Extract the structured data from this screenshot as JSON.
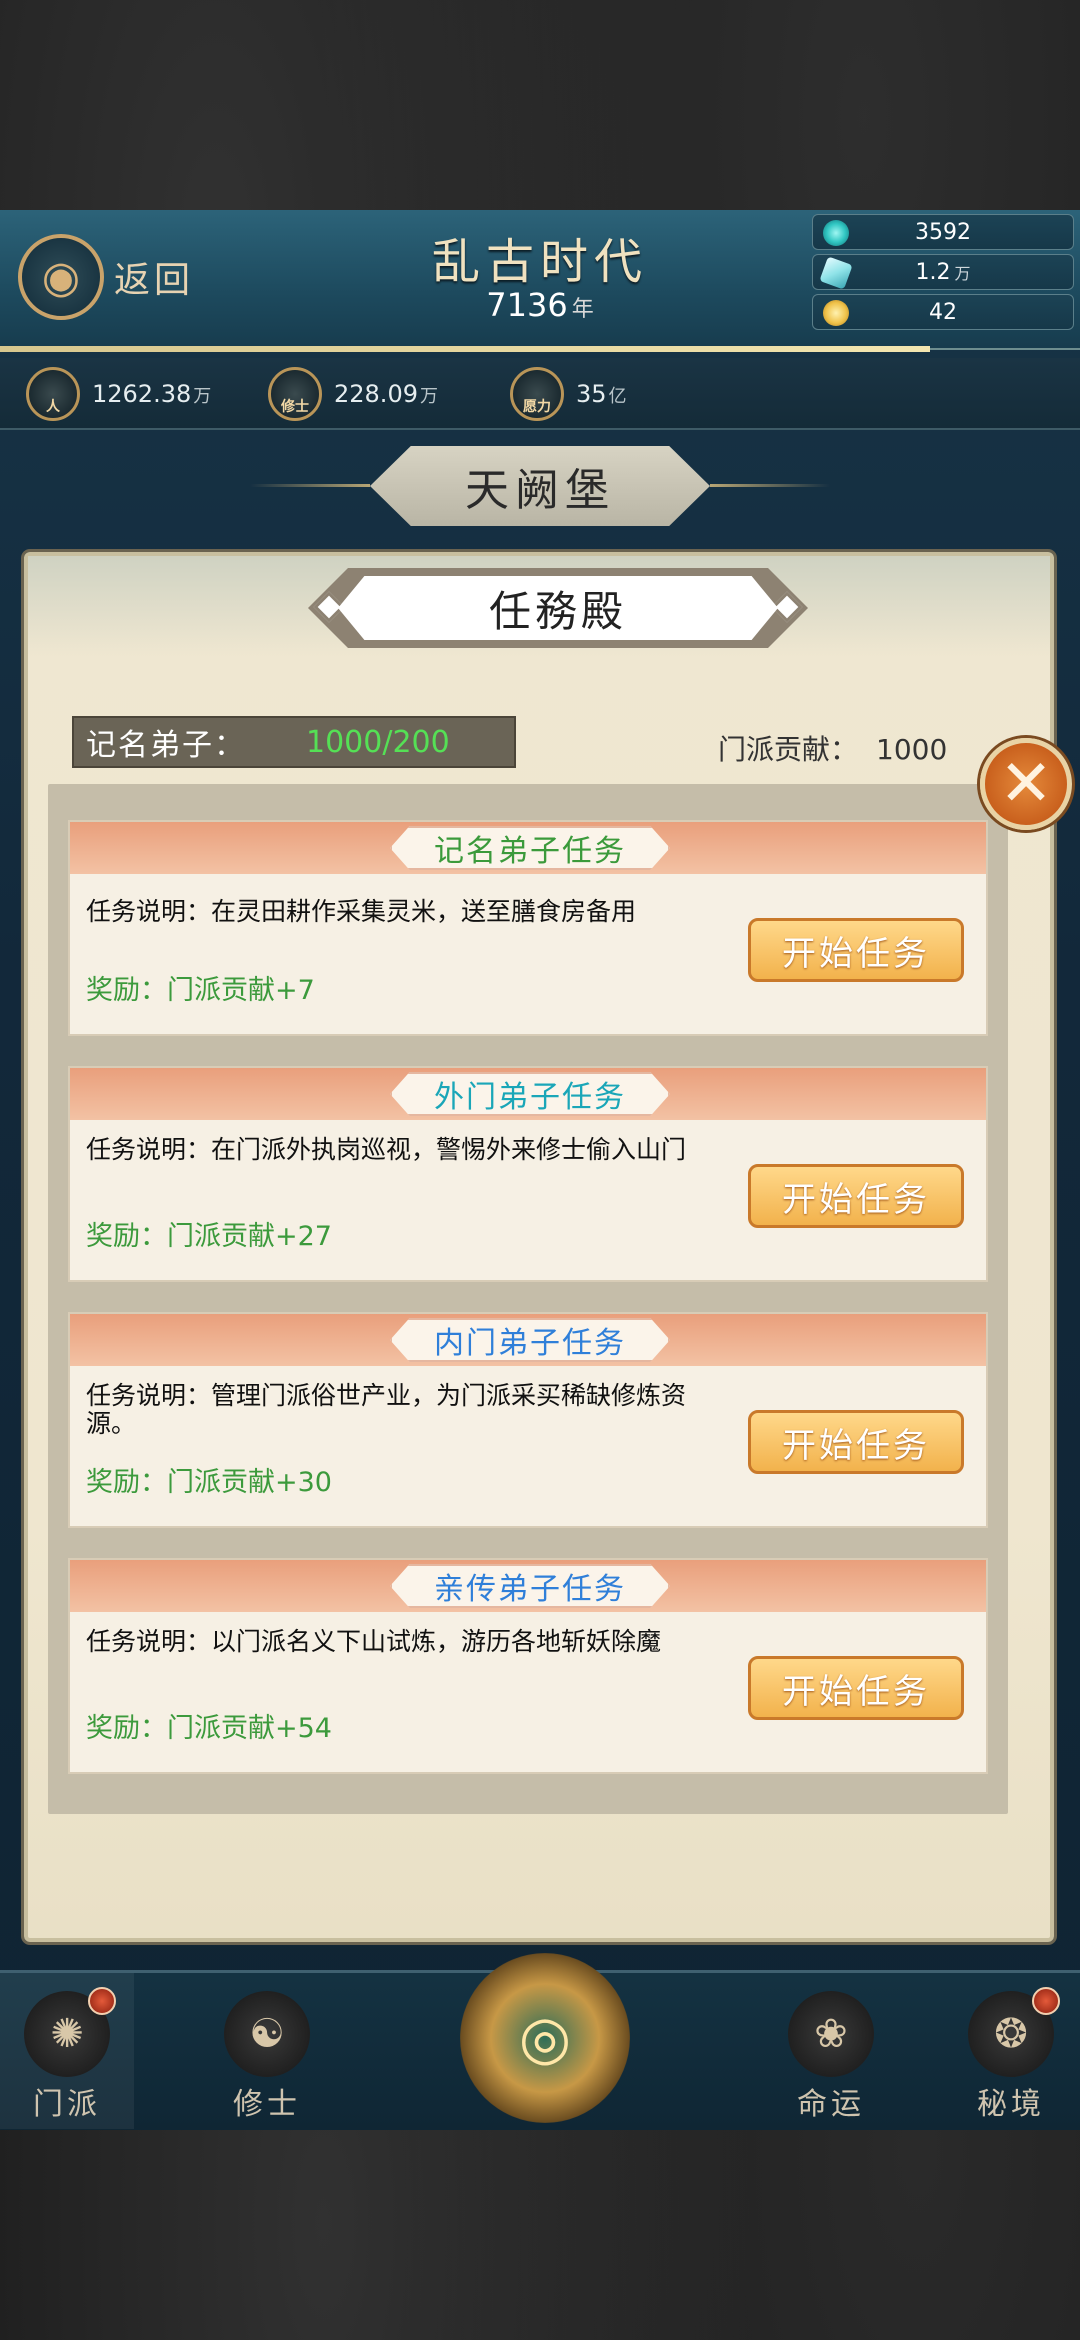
{
  "header": {
    "back_label": "返回",
    "era_title": "乱古时代",
    "year": "7136",
    "year_unit": "年"
  },
  "resources": [
    {
      "icon": "spirit-stone-icon",
      "value": "3592",
      "unit": "",
      "color": "#31c7c3"
    },
    {
      "icon": "crystal-icon",
      "value": "1.2",
      "unit": "万",
      "color": "#8fe3e8"
    },
    {
      "icon": "gold-ingot-icon",
      "value": "42",
      "unit": "",
      "color": "#f0c24a"
    }
  ],
  "stats": [
    {
      "icon": "population-icon",
      "icon_text": "人",
      "value": "1262.38",
      "unit": "万"
    },
    {
      "icon": "cultivator-icon",
      "icon_text": "修士",
      "value": "228.09",
      "unit": "万"
    },
    {
      "icon": "wish-power-icon",
      "icon_text": "愿力",
      "value": "35",
      "unit": "亿"
    }
  ],
  "location": "天阙堡",
  "panel": {
    "title": "任務殿",
    "disciple_label": "记名弟子：",
    "disciple_value": "1000/200",
    "contribution_label": "门派贡献：",
    "contribution_value": "1000"
  },
  "tasks": [
    {
      "name": "记名弟子任务",
      "name_color": "#3b9a3b",
      "desc": "任务说明：在灵田耕作采集灵米，送至膳食房备用",
      "reward": "奖励：门派贡献+7",
      "button": "开始任务"
    },
    {
      "name": "外门弟子任务",
      "name_color": "#1aa6b8",
      "desc": "任务说明：在门派外执岗巡视，警惕外来修士偷入山门",
      "reward": "奖励：门派贡献+27",
      "button": "开始任务"
    },
    {
      "name": "内门弟子任务",
      "name_color": "#2f7fd9",
      "desc": "任务说明：管理门派俗世产业，为门派采买稀缺修炼资源。",
      "reward": "奖励：门派贡献+30",
      "button": "开始任务"
    },
    {
      "name": "亲传弟子任务",
      "name_color": "#2f7fd9",
      "desc": "任务说明：以门派名义下山试炼，游历各地斩妖除魔",
      "reward": "奖励：门派贡献+54",
      "button": "开始任务"
    }
  ],
  "nav": {
    "sect": "门派",
    "cultivator": "修士",
    "fate": "命运",
    "secret_realm": "秘境"
  }
}
